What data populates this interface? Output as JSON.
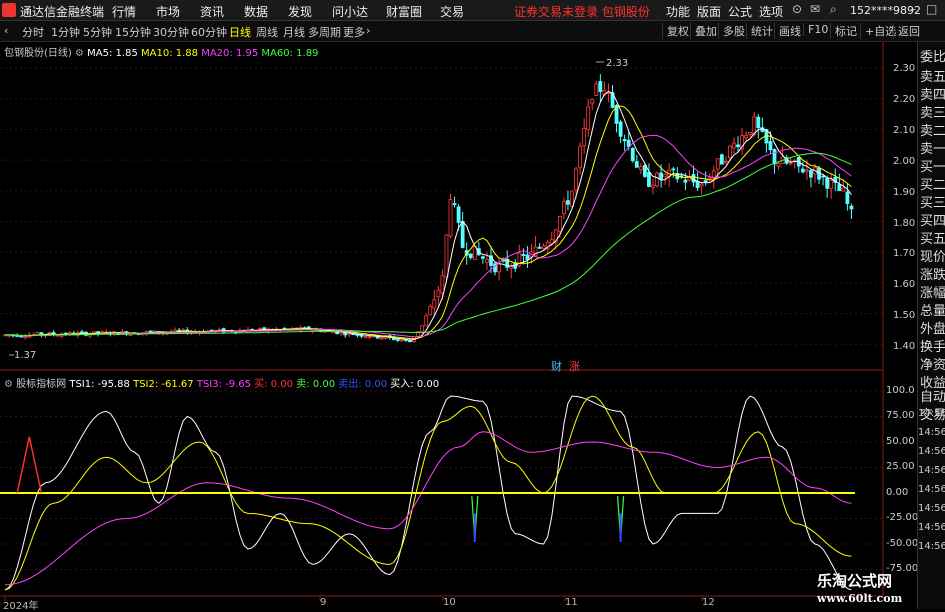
{
  "app": {
    "title": "通达信金融终端",
    "menu": [
      "行情",
      "市场",
      "资讯",
      "数据",
      "发现",
      "问小达",
      "财富圈",
      "交易"
    ],
    "notice": "证券交易未登录  包钢股份",
    "right_menu": [
      "功能",
      "版面",
      "公式",
      "选项"
    ],
    "account": "152****9892"
  },
  "toolbar": {
    "periods": [
      "分时",
      "1分钟",
      "5分钟",
      "15分钟",
      "30分钟",
      "60分钟",
      "日线",
      "周线",
      "月线",
      "多周期",
      "更多"
    ],
    "active_period": "日线",
    "right_buttons": [
      "复权",
      "叠加",
      "多股",
      "统计",
      "画线",
      "F10",
      "标记",
      "+自选",
      "返回"
    ]
  },
  "main_chart": {
    "stock_label": "包钢股份(日线)",
    "ma": [
      {
        "label": "MA5: 1.85",
        "color": "#ffffff"
      },
      {
        "label": "MA10: 1.88",
        "color": "#ffff00"
      },
      {
        "label": "MA20: 1.95",
        "color": "#ff40ff"
      },
      {
        "label": "MA60: 1.89",
        "color": "#40ff40"
      }
    ],
    "high_label": "2.33",
    "low_label": "1.37",
    "markers": [
      {
        "text": "财",
        "color": "#40c0ff"
      },
      {
        "text": "涨",
        "color": "#ff4040"
      }
    ],
    "y_ticks": [
      "2.30",
      "2.20",
      "2.10",
      "2.00",
      "1.90",
      "1.80",
      "1.70",
      "1.60",
      "1.50",
      "1.40"
    ]
  },
  "indicator": {
    "name": "股标指标网",
    "values": [
      {
        "label": "TSI1: -95.88",
        "color": "#ffffff"
      },
      {
        "label": "TSI2: -61.67",
        "color": "#ffff00"
      },
      {
        "label": "TSI3: -9.65",
        "color": "#ff40ff"
      },
      {
        "label": "买: 0.00",
        "color": "#ff3030"
      },
      {
        "label": "卖: 0.00",
        "color": "#40ff40"
      },
      {
        "label": "卖出: 0.00",
        "color": "#3050ff"
      },
      {
        "label": "买入: 0.00",
        "color": "#ffffff"
      }
    ],
    "y_ticks": [
      "100.0",
      "75.00",
      "50.00",
      "25.00",
      "0.00",
      "-25.00",
      "-50.00",
      "-75.00"
    ]
  },
  "sidebar": {
    "items": [
      "委比",
      "卖五",
      "卖四",
      "卖三",
      "卖二",
      "卖一",
      "买一",
      "买二",
      "买三",
      "买四",
      "买五",
      "现价",
      "涨跌",
      "涨幅",
      "总量",
      "外盘",
      "换手",
      "净资",
      "收益",
      "自动",
      "交易"
    ],
    "times": [
      "14:56",
      "14:56",
      "14:56",
      "14:56",
      "14:56",
      "14:56",
      "14:56",
      "14:56"
    ]
  },
  "x_axis": [
    "2024年",
    "9",
    "10",
    "11",
    "12"
  ],
  "watermark": {
    "line1": "乐淘公式网",
    "line2": "www.60lt.com"
  }
}
